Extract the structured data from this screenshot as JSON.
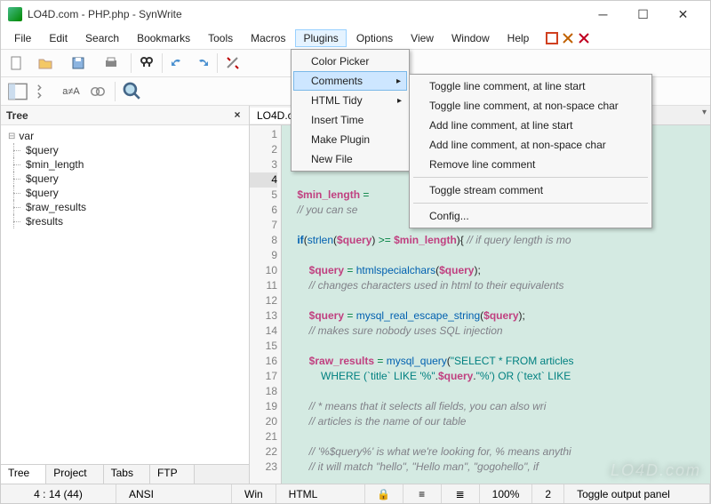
{
  "window": {
    "title": "LO4D.com - PHP.php - SynWrite"
  },
  "menubar": {
    "items": [
      "File",
      "Edit",
      "Search",
      "Bookmarks",
      "Tools",
      "Macros",
      "Plugins",
      "Options",
      "View",
      "Window",
      "Help"
    ],
    "open_index": 6
  },
  "plugins_menu": {
    "items": [
      {
        "label": "Color Picker",
        "submenu": false
      },
      {
        "label": "Comments",
        "submenu": true,
        "hover": true
      },
      {
        "label": "HTML Tidy",
        "submenu": true
      },
      {
        "label": "Insert Time",
        "submenu": false
      },
      {
        "label": "Make Plugin",
        "submenu": false
      },
      {
        "label": "New File",
        "submenu": false
      }
    ]
  },
  "comments_submenu": {
    "groups": [
      [
        "Toggle line comment, at line start",
        "Toggle line comment, at non-space char",
        "Add line comment, at line start",
        "Add line comment, at non-space char",
        "Remove line comment"
      ],
      [
        "Toggle stream comment"
      ],
      [
        "Config..."
      ]
    ]
  },
  "tree_panel": {
    "title": "Tree",
    "root": "var",
    "children": [
      "$query",
      "$min_length",
      "$query",
      "$query",
      "$raw_results",
      "$results"
    ],
    "tabs": [
      "Tree",
      "Project",
      "Tabs",
      "FTP"
    ],
    "active_tab": 0
  },
  "file_tab": "LO4D.c",
  "editor": {
    "current_line": 4,
    "lines": [
      {
        "n": 1,
        "html": ""
      },
      {
        "n": 2,
        "html": ""
      },
      {
        "n": 3,
        "html": ""
      },
      {
        "n": 4,
        "html": ""
      },
      {
        "n": 5,
        "html": "    <span class='k-var'>$min_length</span> <span class='k-op'>=</span>"
      },
      {
        "n": 6,
        "html": "    <span class='k-comm'>// you can se</span>"
      },
      {
        "n": 7,
        "html": ""
      },
      {
        "n": 8,
        "html": "    <span class='k-kw'>if</span>(<span class='k-func'>strlen</span>(<span class='k-var'>$query</span>) <span class='k-op'>&gt;=</span> <span class='k-var'>$min_length</span>){ <span class='k-comm'>// if query length is mo</span>"
      },
      {
        "n": 9,
        "html": ""
      },
      {
        "n": 10,
        "html": "        <span class='k-var'>$query</span> <span class='k-op'>=</span> <span class='k-func'>htmlspecialchars</span>(<span class='k-var'>$query</span>);"
      },
      {
        "n": 11,
        "html": "        <span class='k-comm'>// changes characters used in html to their equivalents</span>"
      },
      {
        "n": 12,
        "html": ""
      },
      {
        "n": 13,
        "html": "        <span class='k-var'>$query</span> <span class='k-op'>=</span> <span class='k-func'>mysql_real_escape_string</span>(<span class='k-var'>$query</span>);"
      },
      {
        "n": 14,
        "html": "        <span class='k-comm'>// makes sure nobody uses SQL injection</span>"
      },
      {
        "n": 15,
        "html": ""
      },
      {
        "n": 16,
        "html": "        <span class='k-var'>$raw_results</span> <span class='k-op'>=</span> <span class='k-func'>mysql_query</span>(<span class='k-str'>\"SELECT * FROM articles</span>"
      },
      {
        "n": 17,
        "html": "            <span class='k-str'>WHERE (`title` LIKE '%\"</span>.<span class='k-var'>$query</span>.<span class='k-str'>\"%') OR (`text` LIKE</span>"
      },
      {
        "n": 18,
        "html": ""
      },
      {
        "n": 19,
        "html": "        <span class='k-comm'>// * means that it selects all fields, you can also wri</span>"
      },
      {
        "n": 20,
        "html": "        <span class='k-comm'>// articles is the name of our table</span>"
      },
      {
        "n": 21,
        "html": ""
      },
      {
        "n": 22,
        "html": "        <span class='k-comm'>// '%$query%' is what we're looking for, % means anythi</span>"
      },
      {
        "n": 23,
        "html": "        <span class='k-comm'>// it will match \"hello\", \"Hello man\", \"gogohello\", if </span>"
      }
    ]
  },
  "status": {
    "pos": "4 : 14 (44)",
    "encoding": "ANSI",
    "line_endings": "Win",
    "lexer": "HTML",
    "lock": "🔒",
    "zoom": "100%",
    "extra": "2",
    "hint": "Toggle output panel"
  },
  "watermark": "LO4D.com"
}
